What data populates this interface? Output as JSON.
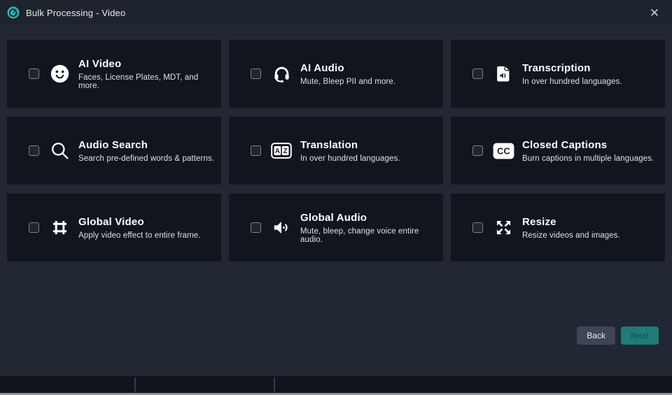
{
  "window": {
    "title": "Bulk Processing - Video",
    "close_glyph": "✕"
  },
  "cards": [
    {
      "icon": "smiley-face-icon",
      "title": "AI Video",
      "description": "Faces, License Plates, MDT, and more.",
      "checked": false
    },
    {
      "icon": "headset-icon",
      "title": "AI Audio",
      "description": "Mute, Bleep PII and more.",
      "checked": false
    },
    {
      "icon": "audio-file-icon",
      "title": "Transcription",
      "description": "In over hundred languages.",
      "checked": false
    },
    {
      "icon": "search-icon",
      "title": "Audio Search",
      "description": "Search pre-defined words & patterns.",
      "checked": false
    },
    {
      "icon": "translate-icon",
      "title": "Translation",
      "description": "In over hundred languages.",
      "checked": false
    },
    {
      "icon": "closed-captions-icon",
      "title": "Closed Captions",
      "description": "Burn captions in multiple languages.",
      "checked": false
    },
    {
      "icon": "frame-icon",
      "title": "Global Video",
      "description": "Apply video effect to entire frame.",
      "checked": false
    },
    {
      "icon": "speaker-icon",
      "title": "Global Audio",
      "description": "Mute, bleep, change voice entire audio.",
      "checked": false
    },
    {
      "icon": "resize-icon",
      "title": "Resize",
      "description": "Resize videos and images.",
      "checked": false
    }
  ],
  "footer": {
    "back_label": "Back",
    "next_label": "Next",
    "next_enabled": false
  },
  "colors": {
    "accent_teal": "#1f7c77",
    "logo_teal": "#2eb4bf",
    "window_bg": "#212733",
    "card_bg": "#11151d"
  }
}
